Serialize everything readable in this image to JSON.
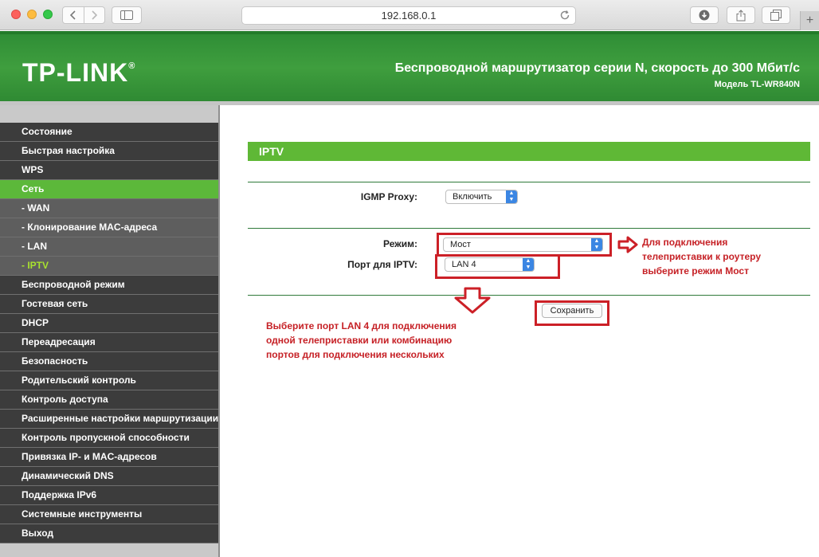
{
  "browser": {
    "url": "192.168.0.1",
    "new_tab_symbol": "+"
  },
  "header": {
    "logo": "TP-LINK",
    "logo_mark": "®",
    "title": "Беспроводной маршрутизатор серии N, скорость до 300 Мбит/с",
    "model": "Модель TL-WR840N"
  },
  "sidebar": {
    "items": [
      {
        "label": "Состояние",
        "type": "item"
      },
      {
        "label": "Быстрая настройка",
        "type": "item"
      },
      {
        "label": "WPS",
        "type": "item"
      },
      {
        "label": "Сеть",
        "type": "active"
      },
      {
        "label": "- WAN",
        "type": "sub"
      },
      {
        "label": "- Клонирование MAC-адреса",
        "type": "sub"
      },
      {
        "label": "- LAN",
        "type": "sub"
      },
      {
        "label": "- IPTV",
        "type": "sub-active"
      },
      {
        "label": "Беспроводной режим",
        "type": "item"
      },
      {
        "label": "Гостевая сеть",
        "type": "item"
      },
      {
        "label": "DHCP",
        "type": "item"
      },
      {
        "label": "Переадресация",
        "type": "item"
      },
      {
        "label": "Безопасность",
        "type": "item"
      },
      {
        "label": "Родительский контроль",
        "type": "item"
      },
      {
        "label": "Контроль доступа",
        "type": "item"
      },
      {
        "label": "Расширенные настройки маршрутизации",
        "type": "item"
      },
      {
        "label": "Контроль пропускной способности",
        "type": "item"
      },
      {
        "label": "Привязка IP- и MAC-адресов",
        "type": "item"
      },
      {
        "label": "Динамический DNS",
        "type": "item"
      },
      {
        "label": "Поддержка IPv6",
        "type": "item"
      },
      {
        "label": "Системные инструменты",
        "type": "item"
      },
      {
        "label": "Выход",
        "type": "item"
      }
    ]
  },
  "main": {
    "section_title": "IPTV",
    "igmp_label": "IGMP Proxy:",
    "igmp_value": "Включить",
    "mode_label": "Режим:",
    "mode_value": "Мост",
    "port_label": "Порт для IPTV:",
    "port_value": "LAN 4",
    "save_label": "Сохранить"
  },
  "annotations": {
    "mode_note": [
      "Для подключения",
      "телеприставки к роутеру",
      "выберите режим Мост"
    ],
    "port_note": [
      "Выберите порт LAN 4 для подключения",
      "одной телеприставки или комбинацию",
      "портов для подключения нескольких"
    ]
  },
  "colors": {
    "header_green": "#3f9e3e",
    "section_green": "#5fb836",
    "menu_dark": "#3c3c3c",
    "menu_active": "#5cb83a",
    "sub_active_text": "#a8e12f",
    "annotation_red": "#cc2027"
  }
}
